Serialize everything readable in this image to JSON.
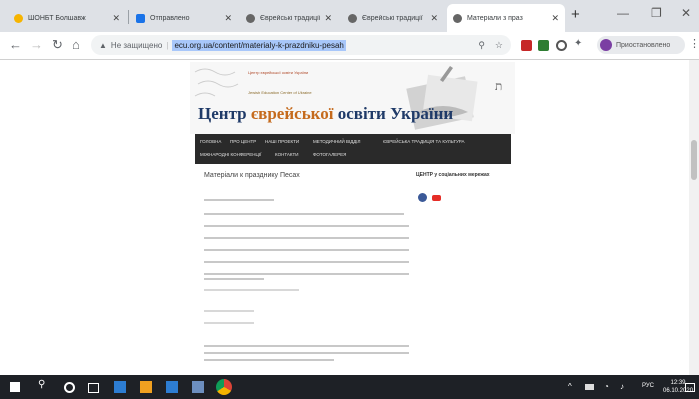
{
  "tabs": [
    {
      "title": "ШОНБТ Болшавж",
      "fav": "#f6b400"
    },
    {
      "title": "Отправлено",
      "fav": "#1a73e8"
    },
    {
      "title": "Єврейські традиції",
      "fav": "#555555"
    },
    {
      "title": "Єврейські традиції",
      "fav": "#555555"
    },
    {
      "title": "Матеріали з праз",
      "fav": "#555555"
    }
  ],
  "omnibox": {
    "security": "Не защищено",
    "url": "ecu.org.ua/content/materialy-k-prazdniku-pesah"
  },
  "profile_label": "Приостановлено",
  "site": {
    "title_part1": "Центр ",
    "title_part2": "єврейської",
    "title_part3": " освіти України",
    "tagline1": "Центр єврейської освіти України",
    "tagline2": "Jewish Education Center of Ukraine"
  },
  "menu": [
    "ГОЛОВНА",
    "ПРО ЦЕНТР",
    "НАШІ ПРОЕКТИ",
    "МЕТОДИЧНИЙ ВІДДІЛ",
    "ЄВРЕЙСЬКА ТРАДИЦІЯ ТА КУЛЬТУРА",
    "МІЖНАРОДНІ КОНФЕРЕНЦІЇ",
    "КОНТАКТИ",
    "ФОТОГАЛЕРЕЯ"
  ],
  "content": {
    "title": "Матеріали к празднику Песах"
  },
  "sidebar": {
    "title": "ЦЕНТР у соціальних мережах"
  },
  "taskbar": {
    "lang": "РУС",
    "time": "12:39",
    "date": "06.10.2020"
  }
}
